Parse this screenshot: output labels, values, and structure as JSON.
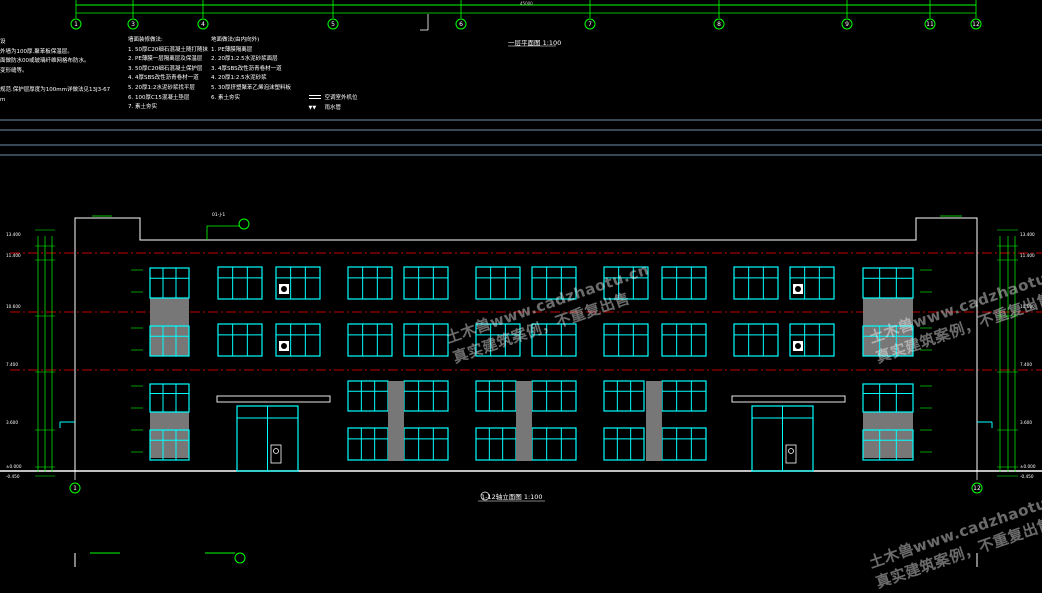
{
  "plan_view": {
    "title": "一层平面图 1:100",
    "axis_labels": [
      "1",
      "3",
      "4",
      "5",
      "6",
      "7",
      "8",
      "9",
      "11",
      "12"
    ],
    "top_dimension": "45000"
  },
  "notes": {
    "col1": [
      "设",
      "外墙为100厚.聚苯板保温层。",
      "面做防水00或玻璃纤维网格布防水。",
      "变形缝等。",
      "",
      "规范.保护层厚度为100mm详做法见13J3-67",
      "m"
    ],
    "col2": [
      "墙面装修做法:",
      "1. 50厚C20细石混凝土随打随抹",
      "2. PE薄膜一层隔离层及保温层",
      "3. 50厚C20细石混凝土保护层",
      "4. 4厚SBS改性沥青卷材一道",
      "5. 20厚1:2水泥砂浆找平层",
      "6. 100厚C15混凝土垫层",
      "7. 素土夯实"
    ],
    "col3": [
      "地面做法(由内向外)",
      "1. PE薄膜隔离层",
      "2. 20厚1:2.5水泥砂浆面层",
      "3. 4厚SBS改性沥青卷材一道",
      "4. 20厚1:2.5水泥砂浆",
      "5. 30厚挤塑聚苯乙烯泡沫塑料板",
      "6. 素土夯实"
    ],
    "legend": [
      "空调室外机位",
      "雨水管"
    ]
  },
  "elevation": {
    "title": "1-12轴立面图 1:100",
    "end_axes": [
      "1",
      "12"
    ],
    "left_elevations": [
      "13.400",
      "11.400",
      "10.600",
      "7.400",
      "3.600",
      "±0.000",
      "-0.450"
    ],
    "right_elevations": [
      "13.400",
      "11.400",
      "10.600",
      "7.400",
      "3.600",
      "±0.000",
      "-0.450"
    ],
    "callout": "01-J-1"
  },
  "watermark": {
    "line1": "土木兽www.cadzhaotu.cn",
    "line2": "真实建筑案例，不重复出售"
  },
  "colors": {
    "background": "#000000",
    "window": "#00ffff",
    "grid": "#00ff00",
    "axis": "#ff0000",
    "outline": "#ffffff",
    "stone": "#777777"
  }
}
